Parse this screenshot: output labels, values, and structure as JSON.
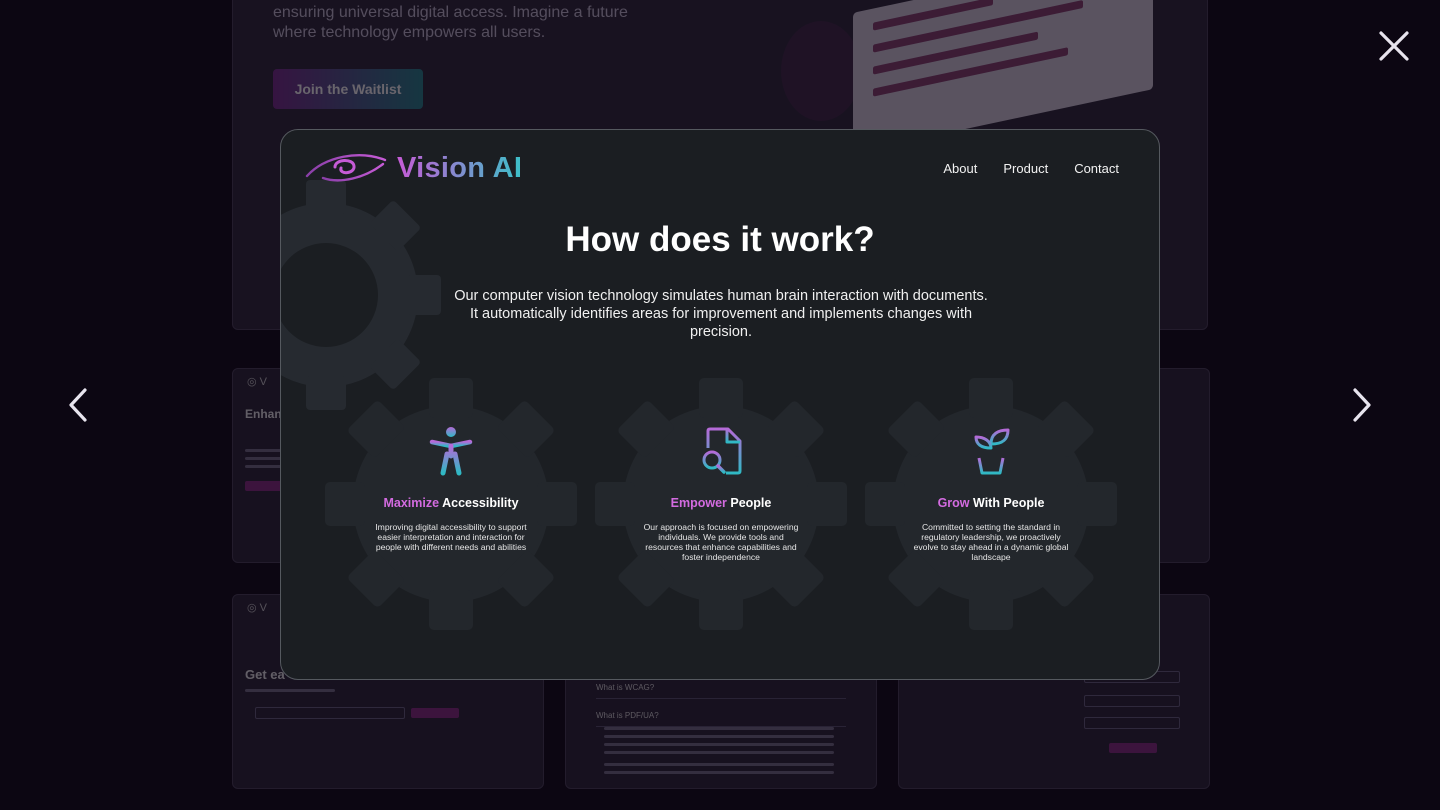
{
  "background": {
    "hero": {
      "text": "ensuring universal digital access. Imagine a future where technology empowers all users.",
      "cta_label": "Join the Waitlist"
    },
    "left_card": {
      "title": "Enhan Docu"
    },
    "bottom_left_card": {
      "title": "Get ea"
    },
    "faq_card": {
      "items": [
        "What is WCAG?",
        "What is PDF/UA?"
      ]
    }
  },
  "controls": {
    "close_glyph": "close-icon",
    "prev_glyph": "chevron-left-icon",
    "next_glyph": "chevron-right-icon"
  },
  "modal": {
    "brand": "Vision AI",
    "nav": [
      "About",
      "Product",
      "Contact"
    ],
    "headline": "How does it work?",
    "lead": "Our computer vision technology simulates human brain interaction with documents. It automatically identifies areas for improvement and implements changes with precision.",
    "features": [
      {
        "icon": "accessibility-person-icon",
        "highlight": "Maximize",
        "rest": " Accessibility",
        "desc": "Improving digital accessibility to support easier interpretation and interaction for people with different needs and abilities"
      },
      {
        "icon": "document-search-icon",
        "highlight": "Empower",
        "rest": " People",
        "desc": "Our approach is focused on empowering individuals. We provide tools and resources that enhance capabilities and foster independence"
      },
      {
        "icon": "plant-pot-icon",
        "highlight": "Grow",
        "rest": " With People",
        "desc": "Committed to setting the standard in regulatory leadership, we proactively evolve to stay ahead in a dynamic global landscape"
      }
    ]
  },
  "colors": {
    "accent_purple": "#d36be0",
    "accent_teal": "#3cc0c8",
    "modal_bg": "#1b1e22",
    "page_bg": "#0c0612"
  }
}
